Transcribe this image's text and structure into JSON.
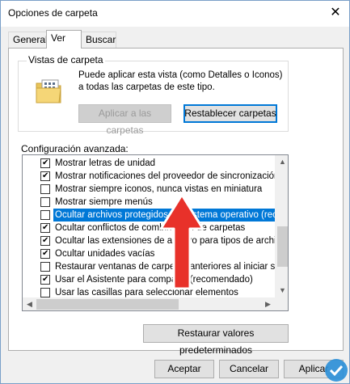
{
  "window": {
    "title": "Opciones de carpeta",
    "close_glyph": "✕"
  },
  "tabs": [
    {
      "label": "General"
    },
    {
      "label": "Ver"
    },
    {
      "label": "Buscar"
    }
  ],
  "folder_views": {
    "label": "Vistas de carpeta",
    "description": "Puede aplicar esta vista (como Detalles o Iconos) a todas las carpetas de este tipo.",
    "apply_label": "Aplicar a las carpetas",
    "reset_label": "Restablecer carpetas"
  },
  "advanced": {
    "label": "Configuración avanzada:",
    "items": [
      {
        "label": "Mostrar letras de unidad",
        "checked": true
      },
      {
        "label": "Mostrar notificaciones del proveedor de sincronización",
        "checked": true
      },
      {
        "label": "Mostrar siempre iconos, nunca vistas en miniatura",
        "checked": false
      },
      {
        "label": "Mostrar siempre menús",
        "checked": false
      },
      {
        "label": "Ocultar archivos protegidos del sistema operativo (recome",
        "checked": false,
        "selected": true
      },
      {
        "label": "Ocultar conflictos de combinación de carpetas",
        "checked": true
      },
      {
        "label": "Ocultar las extensiones de archivo para tipos de archivo c",
        "checked": true
      },
      {
        "label": "Ocultar unidades vacías",
        "checked": true
      },
      {
        "label": "Restaurar ventanas de carpetas anteriores al iniciar sesió",
        "checked": false
      },
      {
        "label": "Usar el Asistente para compartir (recomendado)",
        "checked": true
      },
      {
        "label": "Usar las casillas para seleccionar elementos",
        "checked": false
      }
    ]
  },
  "restore_defaults_label": "Restaurar valores predeterminados",
  "footer": {
    "ok_label": "Aceptar",
    "cancel_label": "Cancelar",
    "apply_label": "Aplicar"
  },
  "colors": {
    "accent": "#0078d7",
    "arrow": "#e8312a"
  }
}
